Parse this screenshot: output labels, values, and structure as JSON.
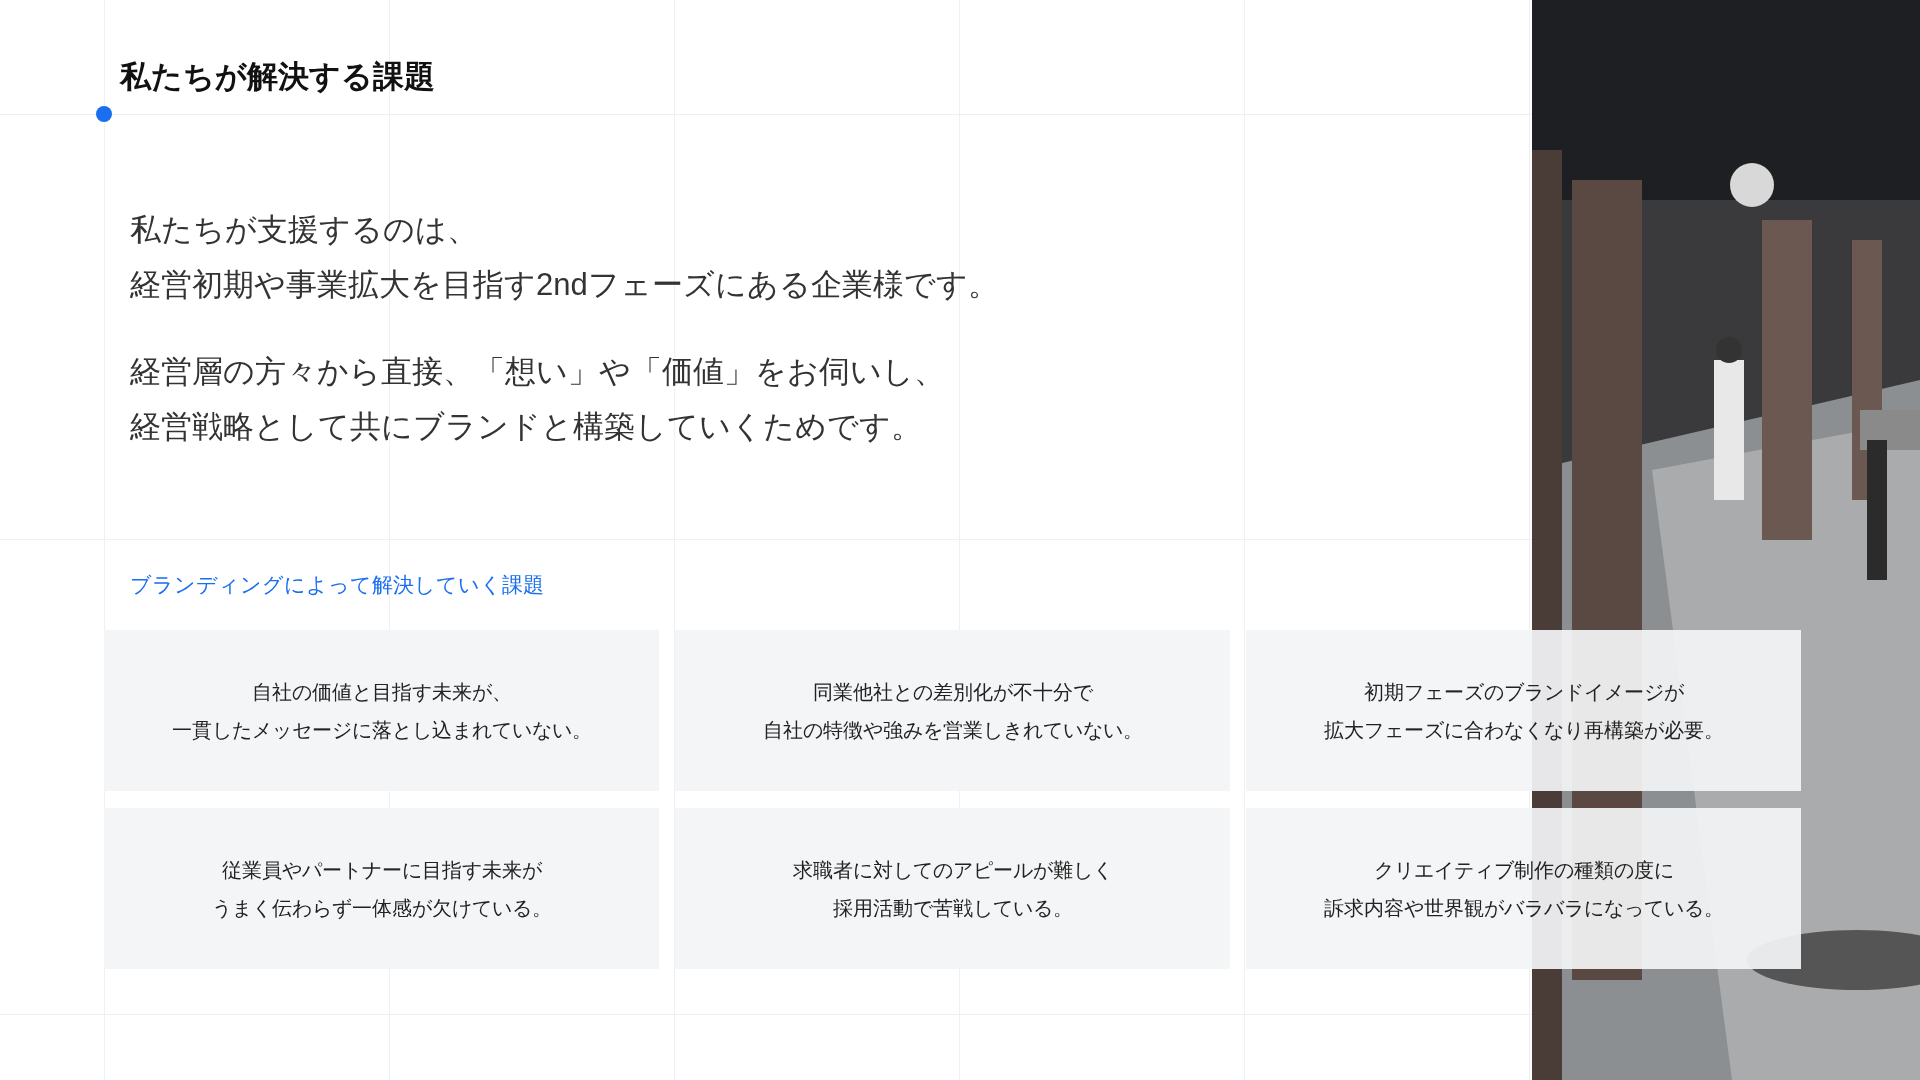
{
  "section_title": "私たちが解決する課題",
  "paragraphs": [
    [
      "私たちが支援するのは、",
      "経営初期や事業拡大を目指す2ndフェーズにある企業様です。"
    ],
    [
      "経営層の方々から直接、「想い」や「価値」をお伺いし、",
      "経営戦略として共にブランドと構築していくためです。"
    ]
  ],
  "issues_heading": "ブランディングによって解決していく課題",
  "issues": [
    {
      "lines": [
        "自社の価値と目指す未来が、",
        "一貫したメッセージに落とし込まれていない。"
      ]
    },
    {
      "lines": [
        "同業他社との差別化が不十分で",
        "自社の特徴や強みを営業しきれていない。"
      ]
    },
    {
      "lines": [
        "初期フェーズのブランドイメージが",
        "拡大フェーズに合わなくなり再構築が必要。"
      ]
    },
    {
      "lines": [
        "従業員やパートナーに目指す未来が",
        "うまく伝わらず一体感が欠けている。"
      ]
    },
    {
      "lines": [
        "求職者に対してのアピールが難しく",
        "採用活動で苦戦している。"
      ]
    },
    {
      "lines": [
        "クリエイティブ制作の種類の度に",
        "訴求内容や世界観がバラバラになっている。"
      ]
    }
  ]
}
